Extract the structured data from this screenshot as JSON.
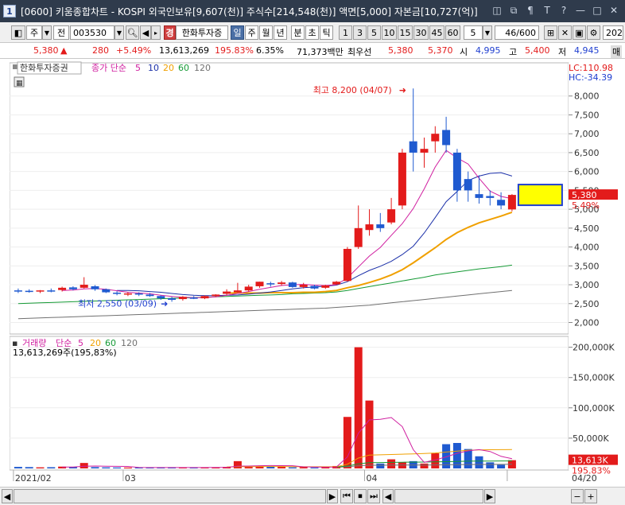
{
  "window": {
    "app_number": "1",
    "title": "[0600] 키움종합차트 - KOSPI 외국인보유[9,607(천)] 주식수[214,548(천)] 액면[5,000] 자본금[10,727(억)]",
    "buttons": [
      "◫",
      "⧉",
      "¶",
      "T",
      "?",
      "—",
      "□",
      "✕"
    ]
  },
  "toolbar": {
    "mode_a": "주",
    "mode_b": "전",
    "code": "003530",
    "broker_tag": "경",
    "broker_name": "한화투자증",
    "periods": [
      "일",
      "주",
      "월",
      "년",
      "분",
      "초",
      "틱"
    ],
    "active_period": "일",
    "intervals": [
      "1",
      "3",
      "5",
      "10",
      "15",
      "30",
      "45",
      "60"
    ],
    "interval_select": "5",
    "count": "46/600",
    "year_field": "202",
    "order_btn": "매"
  },
  "pricebar": {
    "price": "5,380",
    "arrow": "▲",
    "change": "280",
    "change_pct": "+5.49%",
    "volume": "13,613,269",
    "volume_pct": "195.83%",
    "turnover": "6.35%",
    "amount": "71,373백만",
    "best_label": "최우선",
    "best_ask": "5,380",
    "best_bid": "5,370",
    "open_label": "시",
    "open": "4,995",
    "high_label": "고",
    "high": "5,400",
    "low_label": "저",
    "low": "4,945"
  },
  "chart_data": [
    {
      "type": "candlestick",
      "title": "한화투자증권",
      "ma_legend": [
        "종가 단순",
        "5",
        "10",
        "20",
        "60",
        "120"
      ],
      "ma_colors": {
        "5": "#d020a0",
        "10": "#1a2fa8",
        "20": "#f0a000",
        "60": "#159a35",
        "120": "#707070"
      },
      "ylim": [
        1800,
        8500
      ],
      "yticks": [
        2000,
        2500,
        3000,
        3500,
        4000,
        4500,
        5000,
        5500,
        6000,
        6500,
        7000,
        7500,
        8000
      ],
      "ytick_labels": [
        "2,000",
        "2,500",
        "3,000",
        "3,500",
        "4,000",
        "4,500",
        "5,000",
        "5,500",
        "6,000",
        "6,500",
        "7,000",
        "7,500",
        "8,000"
      ],
      "lc_label": "LC:110.98",
      "hc_label": "HC:-34.39",
      "last_price_label": "5,380",
      "last_pct_label": "5.49%",
      "max_annotation": "최고 8,200 (04/07)",
      "min_annotation": "최저 2,550 (03/09)",
      "up_color": "#e31b1b",
      "down_color": "#1f5ad0",
      "candles": [
        {
          "o": 2850,
          "h": 2900,
          "l": 2780,
          "c": 2830
        },
        {
          "o": 2840,
          "h": 2880,
          "l": 2790,
          "c": 2810
        },
        {
          "o": 2820,
          "h": 2860,
          "l": 2780,
          "c": 2850
        },
        {
          "o": 2850,
          "h": 2900,
          "l": 2800,
          "c": 2830
        },
        {
          "o": 2860,
          "h": 2950,
          "l": 2820,
          "c": 2920
        },
        {
          "o": 2930,
          "h": 2960,
          "l": 2850,
          "c": 2880
        },
        {
          "o": 2920,
          "h": 3200,
          "l": 2900,
          "c": 3000
        },
        {
          "o": 2960,
          "h": 2990,
          "l": 2840,
          "c": 2880
        },
        {
          "o": 2880,
          "h": 2900,
          "l": 2780,
          "c": 2800
        },
        {
          "o": 2790,
          "h": 2830,
          "l": 2720,
          "c": 2760
        },
        {
          "o": 2760,
          "h": 2800,
          "l": 2700,
          "c": 2770
        },
        {
          "o": 2770,
          "h": 2800,
          "l": 2700,
          "c": 2740
        },
        {
          "o": 2740,
          "h": 2780,
          "l": 2680,
          "c": 2700
        },
        {
          "o": 2700,
          "h": 2720,
          "l": 2600,
          "c": 2640
        },
        {
          "o": 2640,
          "h": 2680,
          "l": 2550,
          "c": 2600
        },
        {
          "o": 2620,
          "h": 2700,
          "l": 2580,
          "c": 2680
        },
        {
          "o": 2660,
          "h": 2700,
          "l": 2620,
          "c": 2640
        },
        {
          "o": 2640,
          "h": 2720,
          "l": 2620,
          "c": 2700
        },
        {
          "o": 2700,
          "h": 2750,
          "l": 2680,
          "c": 2740
        },
        {
          "o": 2760,
          "h": 2880,
          "l": 2730,
          "c": 2820
        },
        {
          "o": 2800,
          "h": 3050,
          "l": 2790,
          "c": 2850
        },
        {
          "o": 2850,
          "h": 3000,
          "l": 2820,
          "c": 2950
        },
        {
          "o": 2960,
          "h": 3080,
          "l": 2920,
          "c": 3080
        },
        {
          "o": 3040,
          "h": 3080,
          "l": 2950,
          "c": 3020
        },
        {
          "o": 3020,
          "h": 3100,
          "l": 2980,
          "c": 3060
        },
        {
          "o": 3060,
          "h": 3080,
          "l": 2920,
          "c": 2940
        },
        {
          "o": 2940,
          "h": 3050,
          "l": 2900,
          "c": 3000
        },
        {
          "o": 2970,
          "h": 3000,
          "l": 2880,
          "c": 2900
        },
        {
          "o": 2920,
          "h": 3000,
          "l": 2890,
          "c": 2980
        },
        {
          "o": 3010,
          "h": 3100,
          "l": 3000,
          "c": 3080
        },
        {
          "o": 3100,
          "h": 4000,
          "l": 3080,
          "c": 3950
        },
        {
          "o": 4000,
          "h": 5100,
          "l": 3950,
          "c": 4500
        },
        {
          "o": 4450,
          "h": 5000,
          "l": 4300,
          "c": 4600
        },
        {
          "o": 4600,
          "h": 4900,
          "l": 4400,
          "c": 4500
        },
        {
          "o": 4650,
          "h": 5300,
          "l": 4600,
          "c": 5000
        },
        {
          "o": 5100,
          "h": 6600,
          "l": 5000,
          "c": 6500
        },
        {
          "o": 6800,
          "h": 8200,
          "l": 6000,
          "c": 6500
        },
        {
          "o": 6500,
          "h": 6900,
          "l": 6100,
          "c": 6600
        },
        {
          "o": 6800,
          "h": 7200,
          "l": 6500,
          "c": 7000
        },
        {
          "o": 7100,
          "h": 7450,
          "l": 6500,
          "c": 6700
        },
        {
          "o": 6500,
          "h": 6600,
          "l": 5200,
          "c": 5500
        },
        {
          "o": 5800,
          "h": 6000,
          "l": 5200,
          "c": 5500
        },
        {
          "o": 5400,
          "h": 5900,
          "l": 5150,
          "c": 5300
        },
        {
          "o": 5350,
          "h": 5500,
          "l": 5100,
          "c": 5300
        },
        {
          "o": 5250,
          "h": 5450,
          "l": 5000,
          "c": 5100
        },
        {
          "o": 4995,
          "h": 5400,
          "l": 4945,
          "c": 5380
        }
      ],
      "ma5": [
        null,
        null,
        null,
        null,
        2850,
        2860,
        2890,
        2900,
        2880,
        2840,
        2800,
        2780,
        2760,
        2720,
        2690,
        2670,
        2660,
        2660,
        2680,
        2720,
        2770,
        2820,
        2880,
        2930,
        2980,
        3000,
        3010,
        2990,
        2980,
        3000,
        3180,
        3470,
        3760,
        3990,
        4310,
        4620,
        5020,
        5540,
        6120,
        6560,
        6360,
        6200,
        5820,
        5480,
        5340,
        5280
      ],
      "ma10": [
        null,
        null,
        null,
        null,
        null,
        null,
        null,
        null,
        null,
        2850,
        2850,
        2840,
        2820,
        2800,
        2770,
        2740,
        2720,
        2710,
        2710,
        2720,
        2730,
        2750,
        2780,
        2810,
        2850,
        2890,
        2920,
        2940,
        2960,
        2990,
        3080,
        3240,
        3380,
        3490,
        3620,
        3800,
        4020,
        4370,
        4780,
        5200,
        5470,
        5760,
        5880,
        5950,
        5970,
        5880
      ],
      "ma20": [
        null,
        null,
        null,
        null,
        null,
        null,
        null,
        null,
        null,
        null,
        null,
        null,
        null,
        null,
        null,
        null,
        null,
        null,
        null,
        2780,
        2780,
        2780,
        2780,
        2790,
        2790,
        2790,
        2800,
        2800,
        2820,
        2850,
        2920,
        2980,
        3060,
        3150,
        3260,
        3400,
        3580,
        3780,
        3980,
        4200,
        4380,
        4520,
        4640,
        4730,
        4820,
        4920
      ],
      "ma60": [
        2500,
        2510,
        2520,
        2530,
        2540,
        2550,
        2560,
        2570,
        2580,
        2590,
        2600,
        2610,
        2620,
        2630,
        2640,
        2650,
        2660,
        2670,
        2680,
        2690,
        2700,
        2710,
        2720,
        2730,
        2740,
        2760,
        2770,
        2780,
        2790,
        2810,
        2850,
        2900,
        2950,
        3000,
        3050,
        3100,
        3150,
        3200,
        3260,
        3300,
        3340,
        3380,
        3420,
        3450,
        3480,
        3520
      ],
      "ma120": [
        2100,
        2110,
        2120,
        2130,
        2140,
        2150,
        2160,
        2170,
        2180,
        2190,
        2200,
        2210,
        2220,
        2230,
        2240,
        2250,
        2260,
        2270,
        2280,
        2290,
        2300,
        2310,
        2320,
        2330,
        2340,
        2350,
        2360,
        2370,
        2380,
        2400,
        2420,
        2440,
        2460,
        2490,
        2520,
        2550,
        2580,
        2610,
        2640,
        2670,
        2700,
        2730,
        2760,
        2790,
        2820,
        2850
      ]
    },
    {
      "type": "bar",
      "title": "거래량",
      "ma_legend": [
        "단순",
        "5",
        "20",
        "60",
        "120"
      ],
      "volume_header": "13,613,269주(195,83%)",
      "ylim": [
        0,
        210000
      ],
      "yticks": [
        50000,
        100000,
        150000,
        200000
      ],
      "ytick_labels": [
        "50,000K",
        "100,000K",
        "150,000K",
        "200,000K"
      ],
      "last_label": "13,613K",
      "last_pct_label": "195.83%",
      "x_labels": [
        {
          "i": 0,
          "t": "2021/02"
        },
        {
          "i": 10,
          "t": "03"
        },
        {
          "i": 32,
          "t": "04"
        },
        {
          "i": 45,
          "t": "04/20"
        }
      ],
      "values": [
        2500,
        2200,
        1800,
        2000,
        3000,
        2500,
        9000,
        2200,
        1800,
        1600,
        1500,
        1400,
        1300,
        1400,
        2000,
        1500,
        1300,
        1400,
        1600,
        2500,
        12000,
        2500,
        3500,
        2800,
        2600,
        1800,
        2000,
        1500,
        2200,
        4000,
        85000,
        200000,
        112000,
        8000,
        15000,
        10000,
        12000,
        8000,
        25000,
        40000,
        42000,
        32000,
        20000,
        10000,
        6000,
        13613
      ],
      "ma5": [
        null,
        null,
        null,
        null,
        2300,
        2300,
        3500,
        3900,
        3700,
        3400,
        3300,
        1700,
        1500,
        1400,
        1500,
        1500,
        1500,
        1500,
        1600,
        1700,
        3800,
        4000,
        4400,
        4700,
        4600,
        4500,
        2600,
        2300,
        2100,
        2300,
        19000,
        58000,
        80000,
        81000,
        84000,
        69000,
        31000,
        10000,
        14000,
        19000,
        25000,
        29000,
        31000,
        28000,
        20000,
        16000
      ],
      "ma20": [
        null,
        null,
        null,
        null,
        null,
        null,
        null,
        null,
        null,
        null,
        null,
        null,
        null,
        null,
        null,
        null,
        null,
        null,
        null,
        2500,
        3000,
        3000,
        3100,
        3100,
        3100,
        3000,
        2700,
        2700,
        2700,
        2800,
        7000,
        17000,
        22000,
        22500,
        23000,
        23500,
        24000,
        24500,
        25500,
        27000,
        28500,
        30000,
        30500,
        30800,
        31000,
        31200
      ],
      "ma60": [
        null,
        null,
        null,
        null,
        null,
        null,
        null,
        null,
        null,
        null,
        null,
        null,
        null,
        null,
        null,
        null,
        null,
        null,
        null,
        null,
        null,
        null,
        null,
        null,
        null,
        null,
        null,
        null,
        null,
        2500,
        4000,
        7500,
        9500,
        9700,
        10000,
        10200,
        10400,
        10500,
        10800,
        11200,
        11600,
        11900,
        12100,
        12200,
        12300,
        12400
      ],
      "ma120": [
        null,
        null,
        null,
        null,
        null,
        null,
        null,
        null,
        null,
        null,
        null,
        null,
        null,
        null,
        null,
        null,
        null,
        null,
        null,
        null,
        null,
        null,
        null,
        null,
        null,
        null,
        null,
        null,
        null,
        2000,
        2700,
        4400,
        5200,
        5300,
        5400,
        5500,
        5600,
        5700,
        5800,
        6000,
        6200,
        6400,
        6500,
        6600,
        6700,
        6800
      ]
    }
  ],
  "bottom": {
    "nav_buttons": [
      "◀",
      "▶",
      "⏮",
      "⏹",
      "⏭",
      "◀",
      "▶"
    ],
    "zoom_minus": "−",
    "zoom_plus": "+"
  }
}
